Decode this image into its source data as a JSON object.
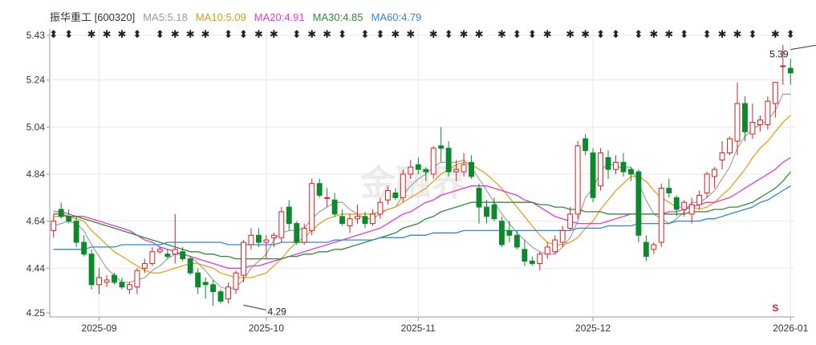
{
  "legend": {
    "stock": "振华重工 [600320]",
    "ma5": "MA5:5.18",
    "ma10": "MA10:5.09",
    "ma20": "MA20:4.91",
    "ma30": "MA30:4.85",
    "ma60": "MA60:4.79"
  },
  "colors": {
    "up": "#d62020",
    "down": "#0a8a2a",
    "ma5": "#a6a6a6",
    "ma10": "#e3a21a",
    "ma20": "#e23ad6",
    "ma30": "#2f8b3a",
    "ma60": "#2f86d8",
    "grid": "#e7e7e7"
  },
  "watermark": "金融界",
  "chart_data": {
    "type": "candlestick",
    "title": "振华重工 [600320]",
    "y_ticks": [
      "5.43",
      "5.24",
      "5.04",
      "4.84",
      "4.64",
      "4.44",
      "4.25"
    ],
    "ylim": [
      4.25,
      5.43
    ],
    "x_ticks": [
      {
        "label": "2025-09",
        "x": 6
      },
      {
        "label": "2025-10",
        "x": 28
      },
      {
        "label": "2025-11",
        "x": 48
      },
      {
        "label": "2025-12",
        "x": 71
      },
      {
        "label": "2026-01",
        "x": 97
      }
    ],
    "annotations": [
      {
        "text": "4.29",
        "x": 25,
        "value": 4.29
      },
      {
        "text": "5.39",
        "x": 101,
        "value": 5.39
      }
    ],
    "ohlc": [
      [
        4.6,
        4.67,
        4.57,
        4.64
      ],
      [
        4.69,
        4.72,
        4.65,
        4.66
      ],
      [
        4.66,
        4.69,
        4.63,
        4.64
      ],
      [
        4.64,
        4.66,
        4.53,
        4.55
      ],
      [
        4.55,
        4.58,
        4.49,
        4.5
      ],
      [
        4.5,
        4.52,
        4.35,
        4.37
      ],
      [
        4.37,
        4.44,
        4.33,
        4.4
      ],
      [
        4.38,
        4.41,
        4.36,
        4.39
      ],
      [
        4.41,
        4.42,
        4.37,
        4.38
      ],
      [
        4.38,
        4.4,
        4.35,
        4.36
      ],
      [
        4.35,
        4.38,
        4.33,
        4.37
      ],
      [
        4.36,
        4.44,
        4.33,
        4.43
      ],
      [
        4.44,
        4.48,
        4.42,
        4.46
      ],
      [
        4.46,
        4.53,
        4.45,
        4.51
      ],
      [
        4.51,
        4.53,
        4.5,
        4.52
      ],
      [
        4.5,
        4.52,
        4.48,
        4.49
      ],
      [
        4.5,
        4.67,
        4.46,
        4.52
      ],
      [
        4.51,
        4.53,
        4.47,
        4.48
      ],
      [
        4.48,
        4.49,
        4.41,
        4.42
      ],
      [
        4.42,
        4.44,
        4.33,
        4.36
      ],
      [
        4.38,
        4.4,
        4.31,
        4.37
      ],
      [
        4.37,
        4.39,
        4.28,
        4.34
      ],
      [
        4.34,
        4.35,
        4.29,
        4.3
      ],
      [
        4.31,
        4.38,
        4.29,
        4.36
      ],
      [
        4.35,
        4.43,
        4.33,
        4.42
      ],
      [
        4.41,
        4.56,
        4.38,
        4.55
      ],
      [
        4.54,
        4.61,
        4.52,
        4.58
      ],
      [
        4.58,
        4.61,
        4.53,
        4.55
      ],
      [
        4.55,
        4.58,
        4.48,
        4.56
      ],
      [
        4.57,
        4.59,
        4.53,
        4.58
      ],
      [
        4.57,
        4.7,
        4.55,
        4.68
      ],
      [
        4.7,
        4.73,
        4.6,
        4.63
      ],
      [
        4.63,
        4.64,
        4.54,
        4.55
      ],
      [
        4.55,
        4.63,
        4.54,
        4.61
      ],
      [
        4.6,
        4.82,
        4.58,
        4.8
      ],
      [
        4.8,
        4.82,
        4.74,
        4.75
      ],
      [
        4.74,
        4.78,
        4.7,
        4.74
      ],
      [
        4.73,
        4.76,
        4.66,
        4.67
      ],
      [
        4.66,
        4.69,
        4.62,
        4.63
      ],
      [
        4.62,
        4.67,
        4.59,
        4.65
      ],
      [
        4.65,
        4.71,
        4.63,
        4.66
      ],
      [
        4.66,
        4.68,
        4.61,
        4.63
      ],
      [
        4.63,
        4.69,
        4.62,
        4.67
      ],
      [
        4.67,
        4.74,
        4.65,
        4.72
      ],
      [
        4.73,
        4.79,
        4.71,
        4.77
      ],
      [
        4.76,
        4.78,
        4.73,
        4.74
      ],
      [
        4.74,
        4.86,
        4.72,
        4.84
      ],
      [
        4.84,
        4.9,
        4.82,
        4.87
      ],
      [
        4.88,
        4.91,
        4.84,
        4.86
      ],
      [
        4.86,
        4.87,
        4.81,
        4.85
      ],
      [
        4.84,
        4.96,
        4.82,
        4.95
      ],
      [
        4.96,
        5.04,
        4.89,
        4.95
      ],
      [
        4.95,
        4.98,
        4.83,
        4.85
      ],
      [
        4.85,
        4.9,
        4.81,
        4.86
      ],
      [
        4.85,
        4.93,
        4.83,
        4.88
      ],
      [
        4.89,
        4.92,
        4.82,
        4.83
      ],
      [
        4.78,
        4.8,
        4.63,
        4.7
      ],
      [
        4.7,
        4.73,
        4.63,
        4.66
      ],
      [
        4.71,
        4.74,
        4.64,
        4.65
      ],
      [
        4.64,
        4.66,
        4.53,
        4.54
      ],
      [
        4.6,
        4.64,
        4.55,
        4.58
      ],
      [
        4.58,
        4.6,
        4.52,
        4.53
      ],
      [
        4.52,
        4.56,
        4.45,
        4.47
      ],
      [
        4.47,
        4.49,
        4.45,
        4.46
      ],
      [
        4.46,
        4.51,
        4.43,
        4.5
      ],
      [
        4.5,
        4.55,
        4.48,
        4.53
      ],
      [
        4.51,
        4.58,
        4.5,
        4.56
      ],
      [
        4.55,
        4.62,
        4.53,
        4.6
      ],
      [
        4.61,
        4.7,
        4.6,
        4.67
      ],
      [
        4.67,
        4.98,
        4.65,
        4.96
      ],
      [
        4.99,
        5.01,
        4.92,
        4.94
      ],
      [
        4.93,
        4.95,
        4.72,
        4.74
      ],
      [
        4.79,
        4.95,
        4.77,
        4.93
      ],
      [
        4.91,
        4.94,
        4.82,
        4.86
      ],
      [
        4.86,
        4.92,
        4.84,
        4.89
      ],
      [
        4.89,
        4.93,
        4.83,
        4.85
      ],
      [
        4.86,
        4.87,
        4.81,
        4.84
      ],
      [
        4.85,
        4.86,
        4.55,
        4.58
      ],
      [
        4.55,
        4.58,
        4.47,
        4.49
      ],
      [
        4.52,
        4.55,
        4.5,
        4.54
      ],
      [
        4.55,
        4.8,
        4.53,
        4.78
      ],
      [
        4.78,
        4.82,
        4.74,
        4.76
      ],
      [
        4.74,
        4.75,
        4.66,
        4.69
      ],
      [
        4.69,
        4.73,
        4.66,
        4.72
      ],
      [
        4.67,
        4.74,
        4.63,
        4.71
      ],
      [
        4.71,
        4.77,
        4.69,
        4.75
      ],
      [
        4.76,
        4.85,
        4.74,
        4.84
      ],
      [
        4.83,
        4.87,
        4.78,
        4.86
      ],
      [
        4.9,
        4.98,
        4.86,
        4.93
      ],
      [
        4.93,
        5.0,
        4.92,
        4.99
      ],
      [
        4.98,
        5.23,
        4.92,
        5.14
      ],
      [
        5.14,
        5.17,
        4.98,
        5.02
      ],
      [
        5.01,
        5.14,
        4.99,
        5.06
      ],
      [
        5.05,
        5.09,
        5.02,
        5.07
      ],
      [
        5.05,
        5.17,
        5.03,
        5.15
      ],
      [
        5.14,
        5.21,
        5.08,
        5.23
      ],
      [
        5.3,
        5.39,
        5.22,
        5.3
      ],
      [
        5.29,
        5.33,
        5.22,
        5.27
      ]
    ],
    "series": [
      {
        "name": "MA5",
        "values": [
          4.62,
          4.63,
          4.64,
          4.63,
          4.6,
          4.54,
          4.49,
          4.44,
          4.41,
          4.38,
          4.38,
          4.39,
          4.4,
          4.43,
          4.45,
          4.48,
          4.5,
          4.5,
          4.49,
          4.46,
          4.43,
          4.39,
          4.36,
          4.35,
          4.36,
          4.39,
          4.44,
          4.47,
          4.5,
          4.56,
          4.59,
          4.6,
          4.6,
          4.61,
          4.65,
          4.68,
          4.7,
          4.72,
          4.72,
          4.69,
          4.67,
          4.65,
          4.65,
          4.67,
          4.69,
          4.7,
          4.75,
          4.79,
          4.82,
          4.84,
          4.87,
          4.89,
          4.89,
          4.89,
          4.9,
          4.87,
          4.82,
          4.77,
          4.72,
          4.67,
          4.63,
          4.59,
          4.56,
          4.53,
          4.51,
          4.5,
          4.5,
          4.53,
          4.57,
          4.64,
          4.74,
          4.78,
          4.85,
          4.89,
          4.87,
          4.87,
          4.87,
          4.8,
          4.73,
          4.67,
          4.65,
          4.63,
          4.65,
          4.68,
          4.72,
          4.72,
          4.74,
          4.77,
          4.82,
          4.87,
          4.95,
          5.0,
          5.03,
          5.05,
          5.07,
          5.11,
          5.18,
          5.18
        ]
      },
      {
        "name": "MA10",
        "values": [
          4.66,
          4.66,
          4.66,
          4.65,
          4.64,
          4.6,
          4.57,
          4.54,
          4.51,
          4.49,
          4.47,
          4.45,
          4.43,
          4.42,
          4.42,
          4.43,
          4.44,
          4.45,
          4.46,
          4.46,
          4.45,
          4.44,
          4.42,
          4.41,
          4.4,
          4.4,
          4.4,
          4.41,
          4.42,
          4.45,
          4.48,
          4.52,
          4.55,
          4.57,
          4.6,
          4.63,
          4.65,
          4.66,
          4.67,
          4.67,
          4.67,
          4.67,
          4.67,
          4.68,
          4.69,
          4.7,
          4.72,
          4.74,
          4.76,
          4.78,
          4.81,
          4.84,
          4.86,
          4.88,
          4.89,
          4.88,
          4.86,
          4.84,
          4.81,
          4.78,
          4.74,
          4.7,
          4.66,
          4.62,
          4.58,
          4.55,
          4.54,
          4.54,
          4.55,
          4.57,
          4.61,
          4.64,
          4.69,
          4.73,
          4.77,
          4.8,
          4.83,
          4.83,
          4.81,
          4.77,
          4.74,
          4.72,
          4.7,
          4.7,
          4.7,
          4.69,
          4.7,
          4.72,
          4.75,
          4.78,
          4.82,
          4.86,
          4.91,
          4.95,
          4.98,
          5.02,
          5.06,
          5.09
        ]
      },
      {
        "name": "MA20",
        "values": [
          4.68,
          4.68,
          4.67,
          4.66,
          4.66,
          4.65,
          4.64,
          4.63,
          4.62,
          4.61,
          4.6,
          4.58,
          4.56,
          4.55,
          4.53,
          4.52,
          4.51,
          4.5,
          4.49,
          4.48,
          4.47,
          4.46,
          4.45,
          4.44,
          4.44,
          4.44,
          4.45,
          4.45,
          4.46,
          4.47,
          4.48,
          4.49,
          4.5,
          4.51,
          4.52,
          4.53,
          4.54,
          4.55,
          4.56,
          4.57,
          4.58,
          4.59,
          4.6,
          4.61,
          4.63,
          4.65,
          4.67,
          4.68,
          4.7,
          4.72,
          4.73,
          4.75,
          4.76,
          4.77,
          4.78,
          4.79,
          4.79,
          4.79,
          4.78,
          4.77,
          4.76,
          4.75,
          4.73,
          4.72,
          4.7,
          4.68,
          4.66,
          4.65,
          4.64,
          4.63,
          4.63,
          4.63,
          4.63,
          4.64,
          4.65,
          4.66,
          4.67,
          4.67,
          4.67,
          4.67,
          4.67,
          4.68,
          4.68,
          4.69,
          4.7,
          4.71,
          4.72,
          4.72,
          4.73,
          4.74,
          4.76,
          4.78,
          4.8,
          4.82,
          4.84,
          4.86,
          4.89,
          4.91
        ]
      },
      {
        "name": "MA30",
        "values": [
          4.67,
          4.67,
          4.66,
          4.66,
          4.65,
          4.64,
          4.63,
          4.62,
          4.61,
          4.6,
          4.59,
          4.58,
          4.57,
          4.56,
          4.55,
          4.54,
          4.53,
          4.52,
          4.51,
          4.51,
          4.5,
          4.5,
          4.49,
          4.49,
          4.48,
          4.48,
          4.48,
          4.48,
          4.48,
          4.48,
          4.48,
          4.49,
          4.49,
          4.5,
          4.5,
          4.51,
          4.51,
          4.52,
          4.52,
          4.53,
          4.54,
          4.55,
          4.56,
          4.57,
          4.58,
          4.59,
          4.61,
          4.62,
          4.63,
          4.65,
          4.66,
          4.68,
          4.69,
          4.7,
          4.71,
          4.72,
          4.72,
          4.72,
          4.72,
          4.72,
          4.72,
          4.72,
          4.72,
          4.72,
          4.71,
          4.71,
          4.7,
          4.7,
          4.69,
          4.69,
          4.68,
          4.68,
          4.68,
          4.67,
          4.67,
          4.67,
          4.67,
          4.67,
          4.67,
          4.67,
          4.67,
          4.67,
          4.67,
          4.67,
          4.68,
          4.68,
          4.68,
          4.69,
          4.69,
          4.7,
          4.7,
          4.71,
          4.72,
          4.74,
          4.76,
          4.78,
          4.81,
          4.85
        ]
      },
      {
        "name": "MA60",
        "values": [
          4.52,
          4.52,
          4.52,
          4.52,
          4.52,
          4.53,
          4.53,
          4.53,
          4.53,
          4.54,
          4.54,
          4.54,
          4.54,
          4.54,
          4.54,
          4.55,
          4.55,
          4.55,
          4.55,
          4.55,
          4.55,
          4.55,
          4.55,
          4.54,
          4.54,
          4.54,
          4.54,
          4.54,
          4.54,
          4.54,
          4.55,
          4.55,
          4.55,
          4.55,
          4.55,
          4.55,
          4.55,
          4.56,
          4.56,
          4.56,
          4.56,
          4.56,
          4.56,
          4.57,
          4.57,
          4.57,
          4.57,
          4.58,
          4.58,
          4.58,
          4.59,
          4.59,
          4.59,
          4.59,
          4.6,
          4.6,
          4.6,
          4.6,
          4.6,
          4.6,
          4.6,
          4.6,
          4.6,
          4.6,
          4.6,
          4.6,
          4.6,
          4.6,
          4.6,
          4.61,
          4.61,
          4.61,
          4.61,
          4.62,
          4.62,
          4.62,
          4.62,
          4.63,
          4.63,
          4.63,
          4.63,
          4.63,
          4.64,
          4.64,
          4.64,
          4.64,
          4.65,
          4.65,
          4.66,
          4.67,
          4.68,
          4.69,
          4.7,
          4.72,
          4.73,
          4.75,
          4.77,
          4.79
        ]
      }
    ],
    "signal_marks": [
      "⬍",
      "⬍",
      "✱",
      "✱",
      "✱",
      "⬍",
      "⬍",
      "✱",
      "✱",
      "✱",
      "⬍",
      "⬍",
      "✱",
      "✱",
      "⬍",
      "✱",
      "✱",
      "⬍",
      "⬍",
      "⬍",
      "✱",
      "✱",
      "✱",
      "⬍",
      "✱",
      "✱",
      "✱",
      "⬍",
      "⬍",
      "✱",
      "✱",
      "✱",
      "⬍",
      "⬍",
      "⬍",
      "✱",
      "✱",
      "⬍",
      "⬍",
      "✱",
      "✱",
      "⬍",
      "✱",
      "⬍"
    ]
  }
}
